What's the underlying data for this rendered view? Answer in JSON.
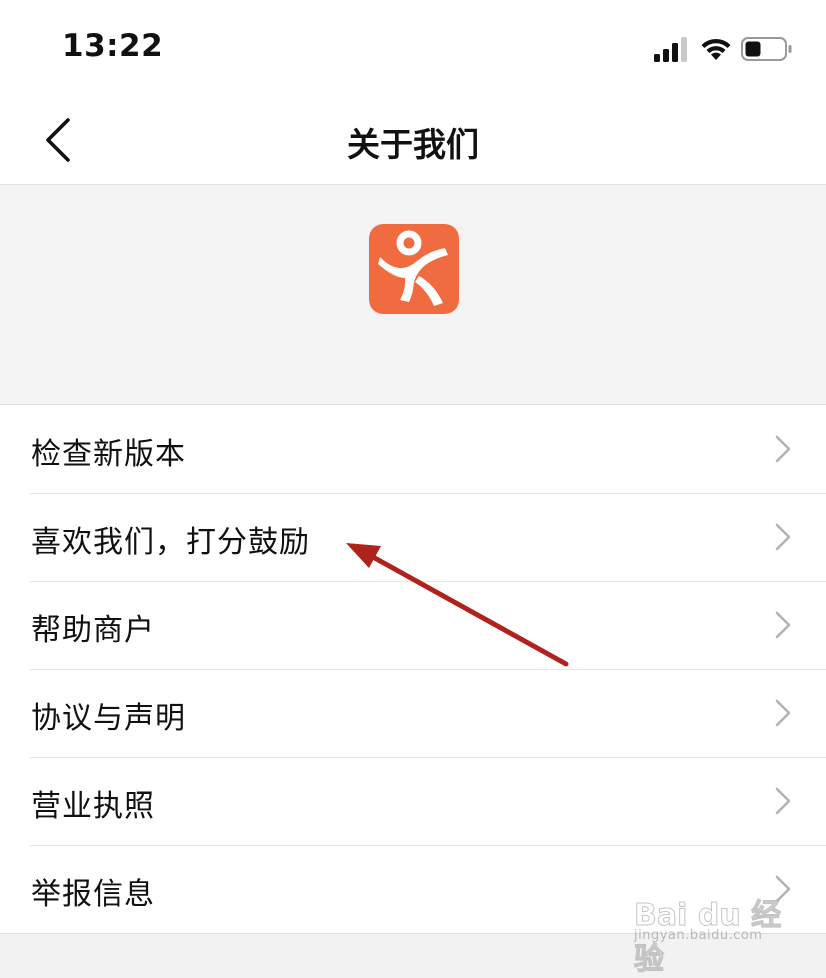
{
  "status_bar": {
    "time": "13:22",
    "signal_icon": "cellular-signal-icon",
    "wifi_icon": "wifi-icon",
    "battery_icon": "battery-icon"
  },
  "nav": {
    "title": "关于我们",
    "back_icon": "chevron-left-icon"
  },
  "app_icon": {
    "name": "dianping-logo",
    "color": "#f06b3f"
  },
  "menu": {
    "items": [
      {
        "label": "检查新版本"
      },
      {
        "label": "喜欢我们，打分鼓励"
      },
      {
        "label": "帮助商户"
      },
      {
        "label": "协议与声明"
      },
      {
        "label": "营业执照"
      },
      {
        "label": "举报信息"
      }
    ],
    "chevron_icon": "chevron-right-icon"
  },
  "annotation": {
    "arrow_color": "#b0221c",
    "points_to": "喜欢我们，打分鼓励"
  },
  "watermark": {
    "line1": "Bai du 经验",
    "line2": "jingyan.baidu.com"
  }
}
